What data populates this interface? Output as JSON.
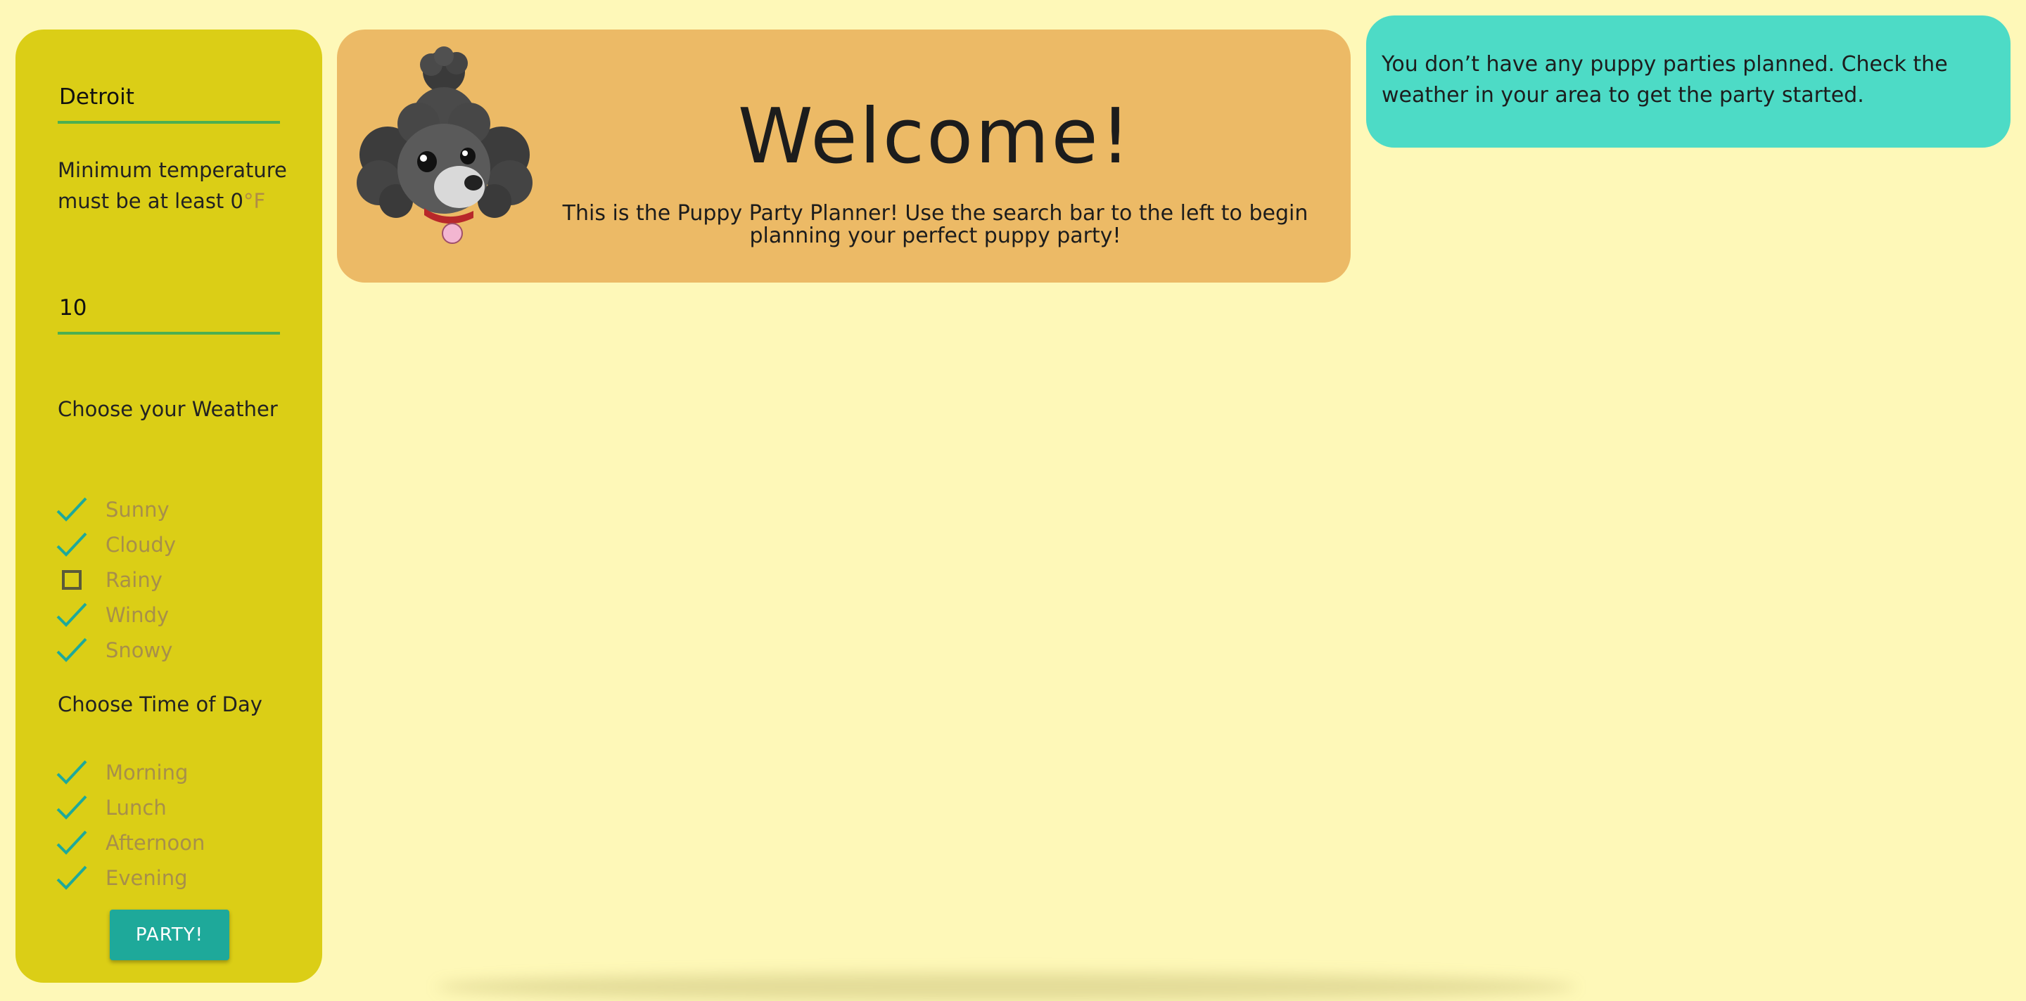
{
  "sidebar": {
    "city_value": "Detroit",
    "temp_hint": "Minimum temperature must be at least 0",
    "temp_unit": "°F",
    "temp_value": "10",
    "weather_title": "Choose your Weather",
    "weather_options": [
      {
        "label": "Sunny",
        "checked": true
      },
      {
        "label": "Cloudy",
        "checked": true
      },
      {
        "label": "Rainy",
        "checked": false
      },
      {
        "label": "Windy",
        "checked": true
      },
      {
        "label": "Snowy",
        "checked": true
      }
    ],
    "time_title": "Choose Time of Day",
    "time_options": [
      {
        "label": "Morning",
        "checked": true
      },
      {
        "label": "Lunch",
        "checked": true
      },
      {
        "label": "Afternoon",
        "checked": true
      },
      {
        "label": "Evening",
        "checked": true
      }
    ],
    "party_button": "PARTY!"
  },
  "welcome": {
    "title": "Welcome!",
    "text": "This is the Puppy Party Planner! Use the search bar to the left to begin planning your perfect puppy party!",
    "image_icon": "poodle-illustration"
  },
  "notice": {
    "text": "You don’t have any puppy parties planned. Check the weather in your area to get the party started."
  },
  "colors": {
    "background": "#fef8b8",
    "sidebar": "#dbce16",
    "welcome_card": "#ecba66",
    "notice_card": "#4ddbc6",
    "accent": "#1ea99a",
    "field_underline": "#4caf50"
  }
}
